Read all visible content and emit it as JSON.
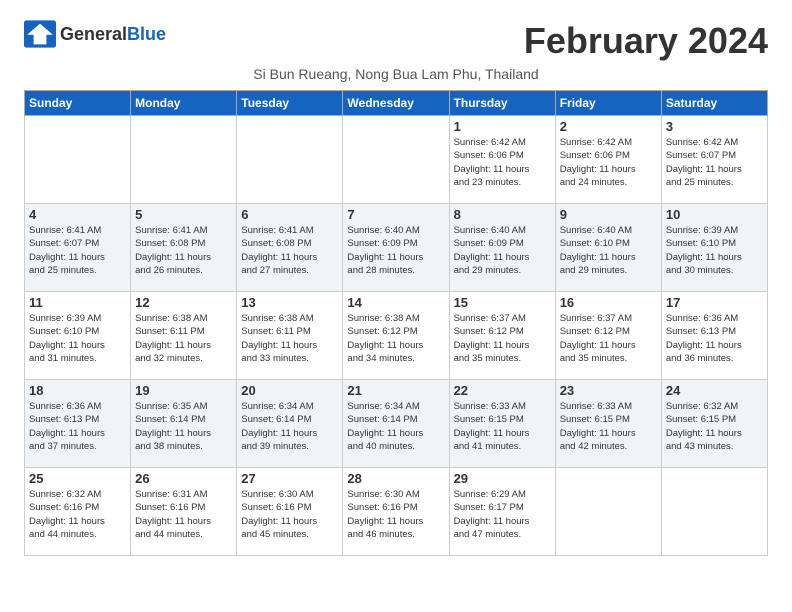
{
  "header": {
    "logo_general": "General",
    "logo_blue": "Blue",
    "month_title": "February 2024",
    "subtitle": "Si Bun Rueang, Nong Bua Lam Phu, Thailand"
  },
  "days_of_week": [
    "Sunday",
    "Monday",
    "Tuesday",
    "Wednesday",
    "Thursday",
    "Friday",
    "Saturday"
  ],
  "weeks": [
    [
      {
        "day": "",
        "info": ""
      },
      {
        "day": "",
        "info": ""
      },
      {
        "day": "",
        "info": ""
      },
      {
        "day": "",
        "info": ""
      },
      {
        "day": "1",
        "info": "Sunrise: 6:42 AM\nSunset: 6:06 PM\nDaylight: 11 hours\nand 23 minutes."
      },
      {
        "day": "2",
        "info": "Sunrise: 6:42 AM\nSunset: 6:06 PM\nDaylight: 11 hours\nand 24 minutes."
      },
      {
        "day": "3",
        "info": "Sunrise: 6:42 AM\nSunset: 6:07 PM\nDaylight: 11 hours\nand 25 minutes."
      }
    ],
    [
      {
        "day": "4",
        "info": "Sunrise: 6:41 AM\nSunset: 6:07 PM\nDaylight: 11 hours\nand 25 minutes."
      },
      {
        "day": "5",
        "info": "Sunrise: 6:41 AM\nSunset: 6:08 PM\nDaylight: 11 hours\nand 26 minutes."
      },
      {
        "day": "6",
        "info": "Sunrise: 6:41 AM\nSunset: 6:08 PM\nDaylight: 11 hours\nand 27 minutes."
      },
      {
        "day": "7",
        "info": "Sunrise: 6:40 AM\nSunset: 6:09 PM\nDaylight: 11 hours\nand 28 minutes."
      },
      {
        "day": "8",
        "info": "Sunrise: 6:40 AM\nSunset: 6:09 PM\nDaylight: 11 hours\nand 29 minutes."
      },
      {
        "day": "9",
        "info": "Sunrise: 6:40 AM\nSunset: 6:10 PM\nDaylight: 11 hours\nand 29 minutes."
      },
      {
        "day": "10",
        "info": "Sunrise: 6:39 AM\nSunset: 6:10 PM\nDaylight: 11 hours\nand 30 minutes."
      }
    ],
    [
      {
        "day": "11",
        "info": "Sunrise: 6:39 AM\nSunset: 6:10 PM\nDaylight: 11 hours\nand 31 minutes."
      },
      {
        "day": "12",
        "info": "Sunrise: 6:38 AM\nSunset: 6:11 PM\nDaylight: 11 hours\nand 32 minutes."
      },
      {
        "day": "13",
        "info": "Sunrise: 6:38 AM\nSunset: 6:11 PM\nDaylight: 11 hours\nand 33 minutes."
      },
      {
        "day": "14",
        "info": "Sunrise: 6:38 AM\nSunset: 6:12 PM\nDaylight: 11 hours\nand 34 minutes."
      },
      {
        "day": "15",
        "info": "Sunrise: 6:37 AM\nSunset: 6:12 PM\nDaylight: 11 hours\nand 35 minutes."
      },
      {
        "day": "16",
        "info": "Sunrise: 6:37 AM\nSunset: 6:12 PM\nDaylight: 11 hours\nand 35 minutes."
      },
      {
        "day": "17",
        "info": "Sunrise: 6:36 AM\nSunset: 6:13 PM\nDaylight: 11 hours\nand 36 minutes."
      }
    ],
    [
      {
        "day": "18",
        "info": "Sunrise: 6:36 AM\nSunset: 6:13 PM\nDaylight: 11 hours\nand 37 minutes."
      },
      {
        "day": "19",
        "info": "Sunrise: 6:35 AM\nSunset: 6:14 PM\nDaylight: 11 hours\nand 38 minutes."
      },
      {
        "day": "20",
        "info": "Sunrise: 6:34 AM\nSunset: 6:14 PM\nDaylight: 11 hours\nand 39 minutes."
      },
      {
        "day": "21",
        "info": "Sunrise: 6:34 AM\nSunset: 6:14 PM\nDaylight: 11 hours\nand 40 minutes."
      },
      {
        "day": "22",
        "info": "Sunrise: 6:33 AM\nSunset: 6:15 PM\nDaylight: 11 hours\nand 41 minutes."
      },
      {
        "day": "23",
        "info": "Sunrise: 6:33 AM\nSunset: 6:15 PM\nDaylight: 11 hours\nand 42 minutes."
      },
      {
        "day": "24",
        "info": "Sunrise: 6:32 AM\nSunset: 6:15 PM\nDaylight: 11 hours\nand 43 minutes."
      }
    ],
    [
      {
        "day": "25",
        "info": "Sunrise: 6:32 AM\nSunset: 6:16 PM\nDaylight: 11 hours\nand 44 minutes."
      },
      {
        "day": "26",
        "info": "Sunrise: 6:31 AM\nSunset: 6:16 PM\nDaylight: 11 hours\nand 44 minutes."
      },
      {
        "day": "27",
        "info": "Sunrise: 6:30 AM\nSunset: 6:16 PM\nDaylight: 11 hours\nand 45 minutes."
      },
      {
        "day": "28",
        "info": "Sunrise: 6:30 AM\nSunset: 6:16 PM\nDaylight: 11 hours\nand 46 minutes."
      },
      {
        "day": "29",
        "info": "Sunrise: 6:29 AM\nSunset: 6:17 PM\nDaylight: 11 hours\nand 47 minutes."
      },
      {
        "day": "",
        "info": ""
      },
      {
        "day": "",
        "info": ""
      }
    ]
  ]
}
